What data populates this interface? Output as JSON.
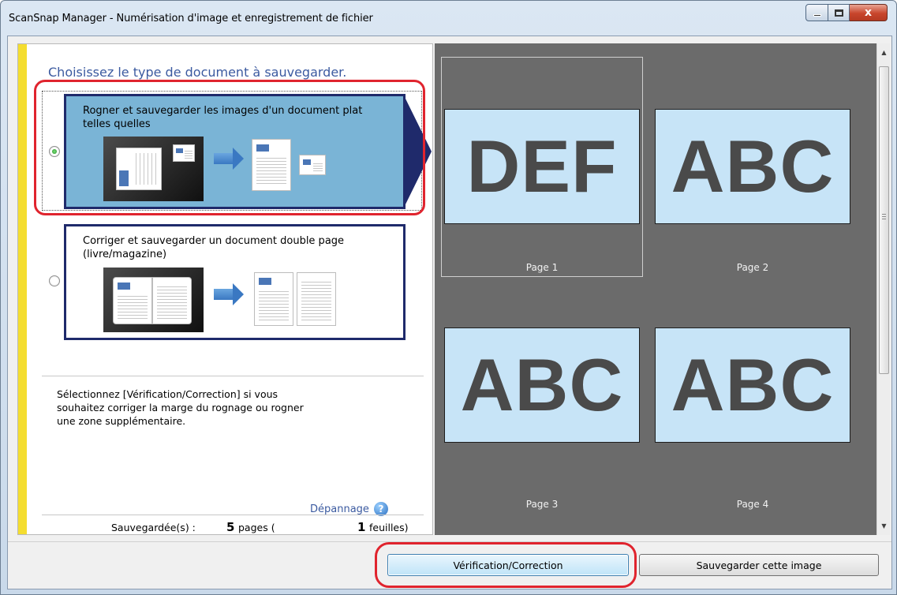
{
  "window": {
    "title": "ScanSnap Manager - Numérisation d'image et enregistrement de fichier",
    "controls": {
      "minimize_icon": "minimize-icon",
      "maximize_icon": "maximize-icon",
      "close_label": "x"
    }
  },
  "left": {
    "heading": "Choisissez le type de document à sauvegarder.",
    "options": [
      {
        "label": "Rogner et sauvegarder les images d'un document plat telles quelles",
        "selected": true
      },
      {
        "label": "Corriger et sauvegarder un document double page (livre/magazine)",
        "selected": false
      }
    ],
    "description": "Sélectionnez [Vérification/Correction] si vous souhaitez corriger la marge du rognage ou rogner une zone supplémentaire.",
    "troubleshoot": "Dépannage",
    "help_icon": "help-icon",
    "saved": {
      "label": "Sauvegardée(s) :",
      "pages_count": "5",
      "pages_label": "pages (",
      "sheets_count": "1",
      "sheets_label": "feuilles)"
    }
  },
  "preview": {
    "pages": [
      {
        "text": "DEF",
        "label": "Page 1",
        "selected": true
      },
      {
        "text": "ABC",
        "label": "Page 2",
        "selected": false
      },
      {
        "text": "ABC",
        "label": "Page 3",
        "selected": false
      },
      {
        "text": "ABC",
        "label": "Page 4",
        "selected": false
      }
    ]
  },
  "buttons": {
    "check_correct": "Vérification/Correction",
    "save_image": "Sauvegarder cette image"
  },
  "colors": {
    "highlight": "#e0242e",
    "accent_text": "#3b5aa0",
    "preview_bg": "#6b6b6b",
    "thumb_bg": "#c7e4f7",
    "selected_card": "#7ab4d6"
  }
}
